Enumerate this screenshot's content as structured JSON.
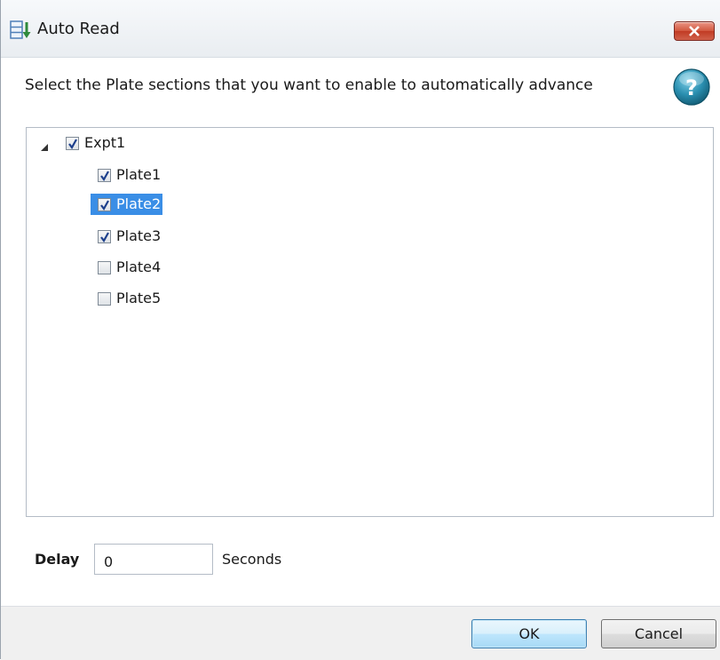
{
  "window": {
    "title": "Auto Read",
    "title_icon": "auto-read-icon",
    "close_icon": "close-icon"
  },
  "instruction": "Select the Plate sections that you want to enable to automatically advance",
  "help_icon": "help-icon",
  "tree": {
    "root": {
      "label": "Expt1",
      "checked": true,
      "expanded": true
    },
    "children": [
      {
        "label": "Plate1",
        "checked": true,
        "selected": false
      },
      {
        "label": "Plate2",
        "checked": true,
        "selected": true
      },
      {
        "label": "Plate3",
        "checked": true,
        "selected": false
      },
      {
        "label": "Plate4",
        "checked": false,
        "selected": false
      },
      {
        "label": "Plate5",
        "checked": false,
        "selected": false
      }
    ]
  },
  "delay": {
    "label": "Delay",
    "value": "0",
    "unit": "Seconds"
  },
  "buttons": {
    "ok": "OK",
    "cancel": "Cancel"
  },
  "colors": {
    "selection": "#3a8ee6",
    "close_button": "#c94a33",
    "help_icon": "#2a8fb0"
  }
}
